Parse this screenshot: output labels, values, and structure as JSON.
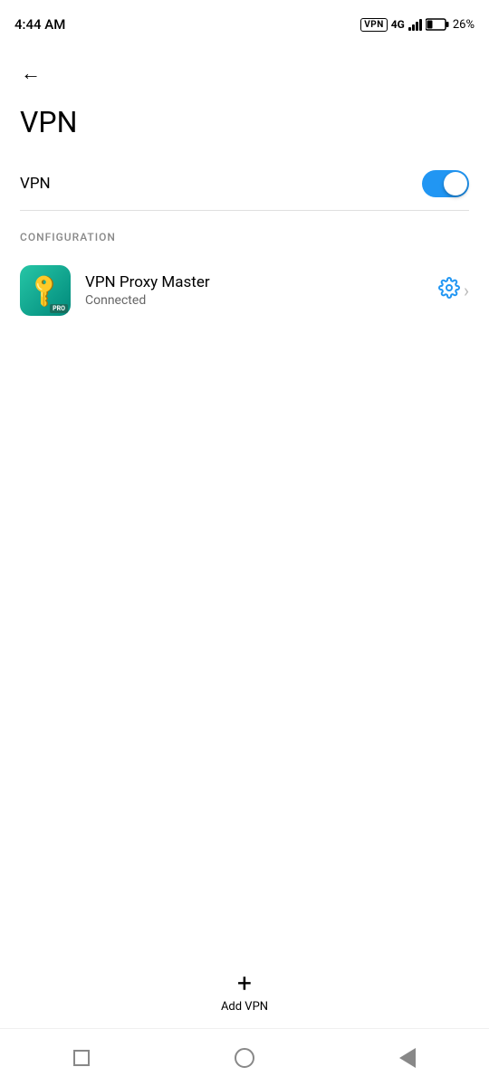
{
  "statusBar": {
    "time": "4:44 AM",
    "vpnBadge": "VPN",
    "signal": "4G",
    "battery": "26%"
  },
  "header": {
    "backLabel": "←",
    "title": "VPN"
  },
  "vpnToggle": {
    "label": "VPN",
    "enabled": true
  },
  "configuration": {
    "sectionLabel": "CONFIGURATION",
    "item": {
      "name": "VPN Proxy Master",
      "status": "Connected",
      "proBadge": "PRO"
    }
  },
  "addVpn": {
    "plus": "+",
    "label": "Add VPN"
  },
  "navigation": {
    "square": "■",
    "circle": "○",
    "triangle": "◄"
  }
}
